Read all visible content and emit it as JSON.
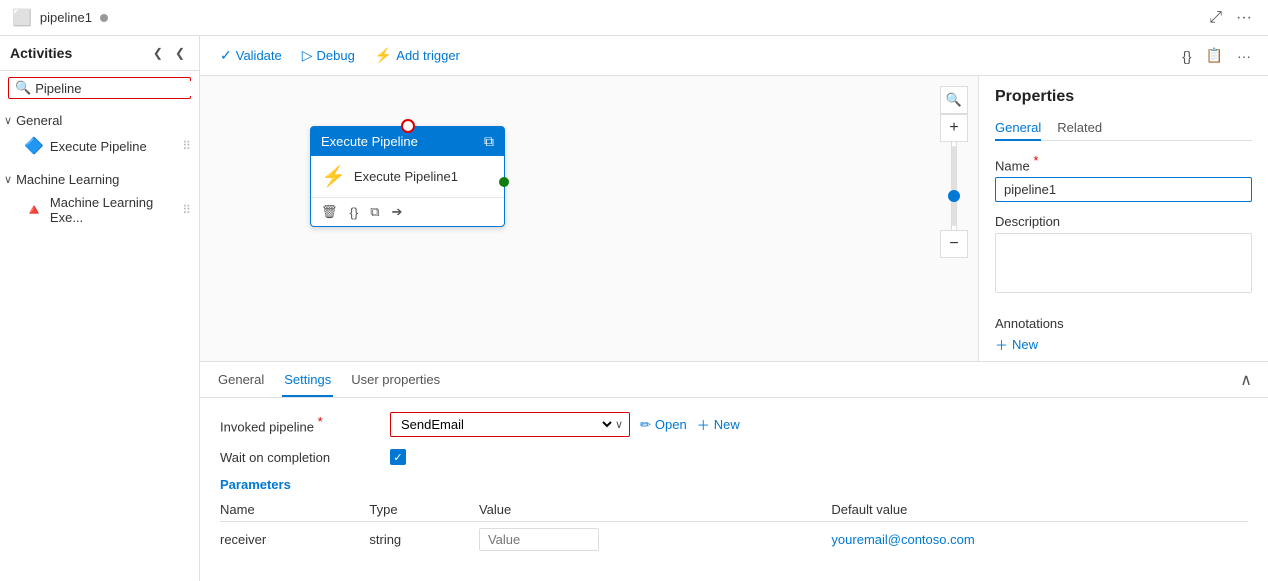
{
  "topbar": {
    "title": "pipeline1",
    "dot": "",
    "icons": {
      "expand": "⤢",
      "more": "···"
    }
  },
  "sidebar": {
    "title": "Activities",
    "collapse_icon": "❮❮",
    "search_placeholder": "Pipeline",
    "search_value": "Pipeline",
    "sections": [
      {
        "label": "General",
        "items": [
          {
            "label": "Execute Pipeline",
            "icon": "🔵"
          }
        ]
      },
      {
        "label": "Machine Learning",
        "items": [
          {
            "label": "Machine Learning Exe...",
            "icon": "🔺"
          }
        ]
      }
    ]
  },
  "toolbar": {
    "validate_label": "Validate",
    "debug_label": "Debug",
    "add_trigger_label": "Add trigger",
    "icons": {
      "json": "{}",
      "publish": "📋",
      "more": "···"
    }
  },
  "canvas": {
    "node": {
      "header": "Execute Pipeline",
      "activity_label": "Execute Pipeline1",
      "footer_icons": [
        "🗑",
        "{}",
        "⧉",
        "➔"
      ]
    }
  },
  "bottom_panel": {
    "tabs": [
      "General",
      "Settings",
      "User properties"
    ],
    "active_tab": "Settings",
    "invoked_pipeline_label": "Invoked pipeline",
    "invoked_pipeline_required": "*",
    "invoked_pipeline_value": "SendEmail",
    "open_label": "Open",
    "new_label": "New",
    "wait_on_completion_label": "Wait on completion",
    "parameters_label": "Parameters",
    "params_headers": [
      "Name",
      "Type",
      "Value",
      "Default value"
    ],
    "params_rows": [
      {
        "name": "receiver",
        "type": "string",
        "value": "Value",
        "default": "youremail@contoso.com"
      }
    ]
  },
  "properties": {
    "title": "Properties",
    "tabs": [
      "General",
      "Related"
    ],
    "active_tab": "General",
    "name_label": "Name",
    "name_required": "*",
    "name_value": "pipeline1",
    "description_label": "Description",
    "description_value": "",
    "annotations_label": "Annotations",
    "new_annotation_label": "New"
  }
}
